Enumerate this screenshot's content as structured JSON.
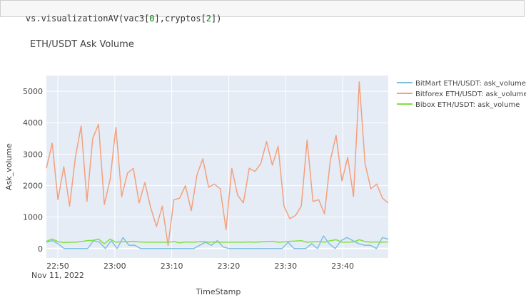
{
  "notebook": {
    "code_parts": [
      {
        "text": "vs.visualizationAV(vac3[",
        "cls": ""
      },
      {
        "text": "0",
        "cls": "num"
      },
      {
        "text": "],cryptos[",
        "cls": ""
      },
      {
        "text": "2",
        "cls": "num"
      },
      {
        "text": "])",
        "cls": ""
      }
    ]
  },
  "chart_data": {
    "type": "line",
    "title": "ETH/USDT Ask Volume",
    "xlabel": "TimeStamp",
    "ylabel": "Ask_volume",
    "x_date_label": "Nov 11, 2022",
    "x_start_time": "22:48",
    "x_end_time": "23:48",
    "x_ticks": [
      "22:50",
      "23:00",
      "23:10",
      "23:20",
      "23:30",
      "23:40"
    ],
    "ylim": [
      -300,
      5500
    ],
    "y_ticks": [
      0,
      1000,
      2000,
      3000,
      4000,
      5000
    ],
    "grid": true,
    "legend_position": "right",
    "series": [
      {
        "name": "BitMart ETH/USDT: ask_volume",
        "color": "#80c0e0",
        "values": [
          200,
          250,
          150,
          0,
          0,
          0,
          0,
          0,
          250,
          200,
          0,
          250,
          0,
          350,
          100,
          100,
          0,
          0,
          0,
          0,
          0,
          0,
          0,
          0,
          0,
          0,
          100,
          200,
          100,
          250,
          50,
          0,
          0,
          0,
          0,
          0,
          0,
          0,
          0,
          0,
          0,
          200,
          0,
          0,
          0,
          150,
          0,
          400,
          150,
          0,
          250,
          350,
          250,
          150,
          100,
          100,
          0,
          350,
          300
        ]
      },
      {
        "name": "Bitforex ETH/USDT: ask_volume",
        "color": "#f4a07c",
        "values": [
          2550,
          3350,
          1550,
          2600,
          1350,
          2900,
          3900,
          1500,
          3500,
          3950,
          1400,
          2200,
          3850,
          1650,
          2400,
          2550,
          1450,
          2100,
          1300,
          700,
          1350,
          100,
          1550,
          1600,
          2000,
          1200,
          2350,
          2850,
          1950,
          2050,
          1900,
          600,
          2550,
          1700,
          1450,
          2550,
          2450,
          2700,
          3400,
          2650,
          3250,
          1350,
          950,
          1050,
          1350,
          3450,
          1500,
          1550,
          1100,
          2800,
          3600,
          2150,
          2900,
          1650,
          5300,
          2700,
          1900,
          2050,
          1600,
          1450
        ]
      },
      {
        "name": "Bibox ETH/USDT: ask_volume",
        "color": "#80e040",
        "values": [
          230,
          300,
          220,
          190,
          200,
          200,
          220,
          250,
          260,
          300,
          150,
          300,
          200,
          220,
          210,
          230,
          210,
          200,
          200,
          200,
          200,
          200,
          220,
          180,
          210,
          200,
          210,
          220,
          200,
          210,
          200,
          200,
          200,
          200,
          200,
          210,
          200,
          210,
          220,
          230,
          200,
          210,
          230,
          240,
          250,
          200,
          210,
          220,
          200,
          250,
          280,
          200,
          200,
          210,
          280,
          220,
          200,
          210,
          200,
          210
        ]
      }
    ]
  }
}
